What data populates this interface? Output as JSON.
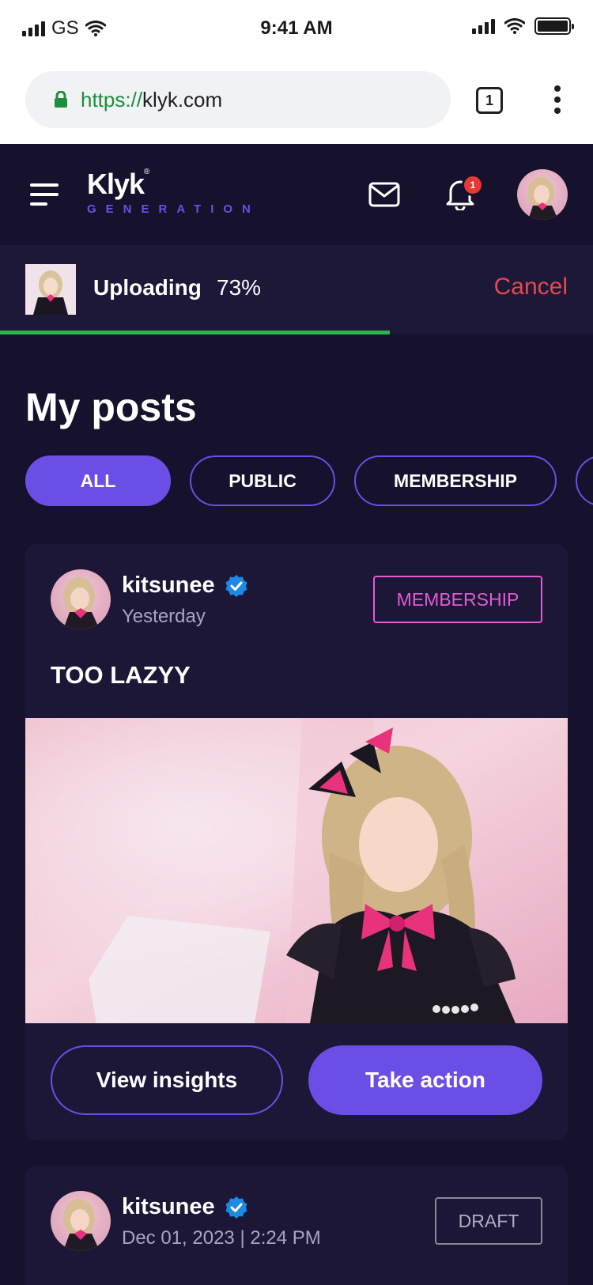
{
  "status_bar": {
    "carrier": "GS",
    "time": "9:41 AM"
  },
  "browser": {
    "url_scheme": "https://",
    "url_host": "klyk.com",
    "tab_count": "1"
  },
  "header": {
    "logo_text": "Klyk",
    "logo_sub": "GENERATION",
    "notification_count": "1",
    "icons": [
      "menu-icon",
      "mail-icon",
      "bell-icon",
      "avatar"
    ]
  },
  "upload": {
    "label": "Uploading",
    "percent_text": "73%",
    "progress": 0.73,
    "cancel_label": "Cancel"
  },
  "page_title": "My posts",
  "filters": [
    {
      "label": "ALL",
      "active": true
    },
    {
      "label": "PUBLIC",
      "active": false
    },
    {
      "label": "MEMBERSHIP",
      "active": false
    }
  ],
  "posts": [
    {
      "username": "kitsunee",
      "verified": true,
      "timestamp": "Yesterday",
      "badge": "MEMBERSHIP",
      "title": "TOO LAZYY",
      "actions": {
        "insights": "View insights",
        "take_action": "Take action"
      }
    },
    {
      "username": "kitsunee",
      "verified": true,
      "timestamp": "Dec 01, 2023 | 2:24 PM",
      "badge": "DRAFT"
    }
  ],
  "colors": {
    "background": "#16112c",
    "card": "#1c1736",
    "accent": "#6b4ee6",
    "membership": "#e45ad4",
    "cancel": "#e5484d",
    "progress": "#2fb44a"
  }
}
